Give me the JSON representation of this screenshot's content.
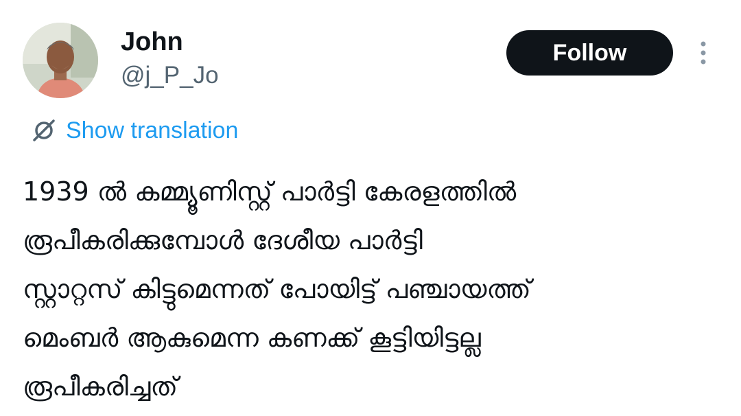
{
  "user": {
    "display_name": "John",
    "handle": "@j_P_Jo",
    "avatar_icon": "profile-photo"
  },
  "actions": {
    "follow_label": "Follow",
    "more_icon": "more-vertical-icon"
  },
  "translation": {
    "label": "Show translation",
    "icon": "translate-icon"
  },
  "tweet": {
    "lines": [
      "1939 ൽ കമ്മ്യൂണിസ്റ്റ് പാർട്ടി കേരളത്തിൽ",
      "രൂപീകരിക്കുമ്പോൾ ദേശീയ പാർട്ടി",
      "സ്റ്റാറ്റസ് കിട്ടുമെന്നത് പോയിട്ട് പഞ്ചായത്ത്",
      "മെംബർ ആകുമെന്ന കണക്ക് കൂട്ടിയിട്ടല്ല",
      "രൂപീകരിച്ചത്"
    ]
  },
  "colors": {
    "text_primary": "#0f1419",
    "text_secondary": "#536471",
    "link": "#1d9bf0",
    "button_bg": "#0f1419"
  }
}
